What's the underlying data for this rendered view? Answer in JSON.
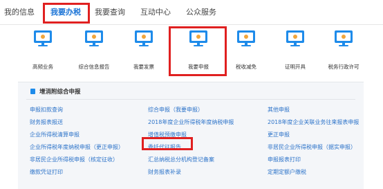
{
  "tabs": [
    {
      "label": "我的信息",
      "active": false
    },
    {
      "label": "我要办税",
      "active": true
    },
    {
      "label": "我要查询",
      "active": false
    },
    {
      "label": "互动中心",
      "active": false
    },
    {
      "label": "公众服务",
      "active": false
    }
  ],
  "services": [
    {
      "label": "高频业务",
      "icon": "monitor-icon"
    },
    {
      "label": "综合信息报告",
      "icon": "monitor-icon"
    },
    {
      "label": "我要发票",
      "icon": "monitor-icon"
    },
    {
      "label": "我要申报",
      "icon": "monitor-icon"
    },
    {
      "label": "税收减免",
      "icon": "monitor-icon"
    },
    {
      "label": "证明开具",
      "icon": "monitor-icon"
    },
    {
      "label": "税务行政许可",
      "icon": "monitor-icon"
    }
  ],
  "panel": {
    "title": "增消附综合申报",
    "links": [
      "申报扣款查询",
      "综合申报（我要申报）",
      "其他申报",
      "财务报表报送",
      "2018年度企业所得税年度纳税申报",
      "2018年度企业关联业务往来报表申报",
      "企业所得税清算申报",
      "增值税预缴申报",
      "更正申报",
      "企业所得税年度纳税申报（更正申报）",
      "委托代征报告",
      "非居民企业所得税申报（据实申报）",
      "非居民企业所得税申报（核定征收）",
      "汇总纳税总分机构登记备案",
      "申报报表打印",
      "缴款凭证打印",
      "财务报表补录",
      "定期定额户缴税"
    ]
  },
  "colors": {
    "accent": "#1a73d6",
    "highlight": "#e02020",
    "link": "#2c73c9"
  }
}
